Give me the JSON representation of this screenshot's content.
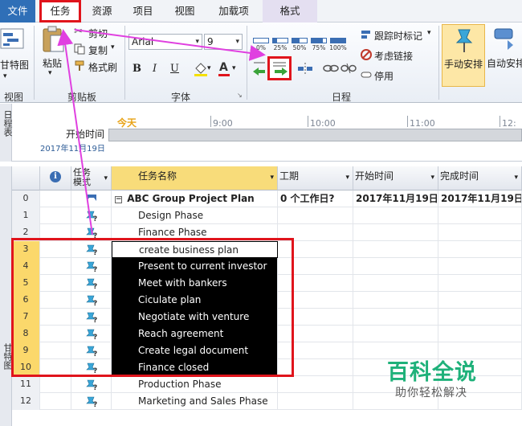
{
  "tabs": [
    {
      "label": "文件"
    },
    {
      "label": "任务"
    },
    {
      "label": "资源"
    },
    {
      "label": "项目"
    },
    {
      "label": "视图"
    },
    {
      "label": "加载项"
    },
    {
      "label": "格式"
    }
  ],
  "ribbon": {
    "view_group": {
      "button": "甘特图",
      "label": "视图"
    },
    "clipboard": {
      "paste": "粘贴",
      "cut": "剪切",
      "copy": "复制",
      "format_painter": "格式刷",
      "label": "剪贴板"
    },
    "font": {
      "name": "Arial",
      "size": "9",
      "bold": "B",
      "italic": "I",
      "underline": "U",
      "label": "字体"
    },
    "schedule": {
      "percents": [
        "0%",
        "25%",
        "50%",
        "75%",
        "100%"
      ],
      "mark_on_track": "跟踪时标记",
      "respect_links": "考虑链接",
      "inactivate": "停用",
      "label": "日程"
    },
    "tasks": {
      "manual": "手动安排",
      "auto": "自动安排"
    }
  },
  "timeline": {
    "side_label": "日程表",
    "today": "今天",
    "start_label": "开始时间",
    "start_date": "2017年11月19日",
    "ticks": [
      "9:00",
      "10:00",
      "11:00",
      "12:"
    ]
  },
  "grid": {
    "side_label": "甘特图",
    "headers": {
      "mode": "任务模式",
      "name": "任务名称",
      "duration": "工期",
      "start": "开始时间",
      "finish": "完成时间"
    },
    "rows": [
      {
        "id": "0",
        "name": "ABC Group Project Plan",
        "duration": "0 个工作日?",
        "start": "2017年11月19日",
        "finish": "2017年11月19日"
      },
      {
        "id": "1",
        "name": "Design Phase"
      },
      {
        "id": "2",
        "name": "Finance Phase"
      },
      {
        "id": "3",
        "name": "create business plan"
      },
      {
        "id": "4",
        "name": "Present to current investor"
      },
      {
        "id": "5",
        "name": "Meet with bankers"
      },
      {
        "id": "6",
        "name": "Ciculate plan"
      },
      {
        "id": "7",
        "name": "Negotiate with venture"
      },
      {
        "id": "8",
        "name": "Reach agreement"
      },
      {
        "id": "9",
        "name": "Create legal document"
      },
      {
        "id": "10",
        "name": "Finance closed"
      },
      {
        "id": "11",
        "name": "Production Phase"
      },
      {
        "id": "12",
        "name": "Marketing and Sales Phase"
      }
    ]
  },
  "watermark": {
    "title": "百科全说",
    "subtitle": "助你轻松解决"
  },
  "colors": {
    "highlight": "#e0141c",
    "arrow": "#e040e0",
    "file_tab": "#2f6fb7"
  }
}
